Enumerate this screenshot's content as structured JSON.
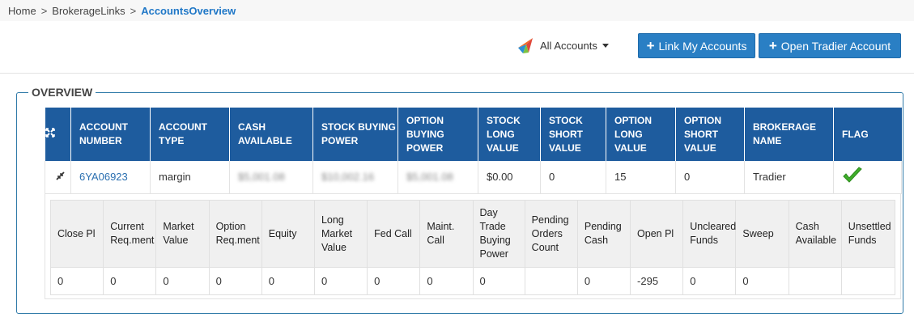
{
  "breadcrumb": {
    "items": [
      "Home",
      "BrokerageLinks"
    ],
    "current": "AccountsOverview",
    "separator": ">"
  },
  "toolbar": {
    "account_select": "All Accounts",
    "link_button": "Link My Accounts",
    "open_button": "Open Tradier Account",
    "button_color": "#2a7fc4"
  },
  "overview": {
    "legend": "OVERVIEW",
    "expand_icon": "expand-icon",
    "headers": {
      "account_number": [
        "ACCOUNT",
        "NUMBER"
      ],
      "account_type": [
        "ACCOUNT",
        "TYPE"
      ],
      "cash_available": [
        "CASH",
        "AVAILABLE"
      ],
      "stock_buying_power": [
        "STOCK BUYING",
        "POWER"
      ],
      "option_buying_power": [
        "OPTION",
        "BUYING",
        "POWER"
      ],
      "stock_long_value": [
        "STOCK",
        "LONG",
        "VALUE"
      ],
      "stock_short_value": [
        "STOCK",
        "SHORT",
        "VALUE"
      ],
      "option_long_value": [
        "OPTION",
        "LONG",
        "VALUE"
      ],
      "option_short_value": [
        "OPTION",
        "SHORT",
        "VALUE"
      ],
      "brokerage_name": [
        "BROKERAGE",
        "NAME"
      ],
      "flag": [
        "FLAG"
      ]
    },
    "row": {
      "account_number": "6YA06923",
      "account_type": "margin",
      "cash_available": "$5,001.08",
      "stock_buying_power": "$10,002.16",
      "option_buying_power": "$5,001.08",
      "stock_long_value": "$0.00",
      "stock_short_value": "0",
      "option_long_value": "15",
      "option_short_value": "0",
      "brokerage_name": "Tradier",
      "flag_icon": "green-checkmark-icon",
      "flag_color": "#3fae2a"
    },
    "header_color": "#1e5c9e"
  },
  "detail": {
    "headers": {
      "close_pl": [
        "Close Pl"
      ],
      "current_req": [
        "Current",
        "Req.ment"
      ],
      "market_value": [
        "Market",
        "Value"
      ],
      "option_req": [
        "Option",
        "Req.ment"
      ],
      "equity": [
        "Equity"
      ],
      "long_market_value": [
        "Long",
        "Market",
        "Value"
      ],
      "fed_call": [
        "Fed Call"
      ],
      "maint_call": [
        "Maint.",
        "Call"
      ],
      "day_trade_bp": [
        "Day",
        "Trade",
        "Buying",
        "Power"
      ],
      "pending_orders": [
        "Pending",
        "Orders",
        "Count"
      ],
      "pending_cash": [
        "Pending",
        "Cash"
      ],
      "open_pl": [
        "Open Pl"
      ],
      "uncleared_funds": [
        "Uncleared",
        "Funds"
      ],
      "sweep": [
        "Sweep"
      ],
      "cash_available": [
        "Cash",
        "Available"
      ],
      "unsettled_funds": [
        "Unsettled",
        "Funds"
      ]
    },
    "row": {
      "close_pl": "0",
      "current_req": "0",
      "market_value": "0",
      "option_req": "0",
      "equity": "0",
      "long_market_value": "0",
      "fed_call": "0",
      "maint_call": "0",
      "day_trade_bp": "0",
      "pending_orders": "",
      "pending_cash": "0",
      "open_pl": "-295",
      "uncleared_funds": "0",
      "sweep": "0",
      "cash_available": "",
      "unsettled_funds": ""
    }
  }
}
